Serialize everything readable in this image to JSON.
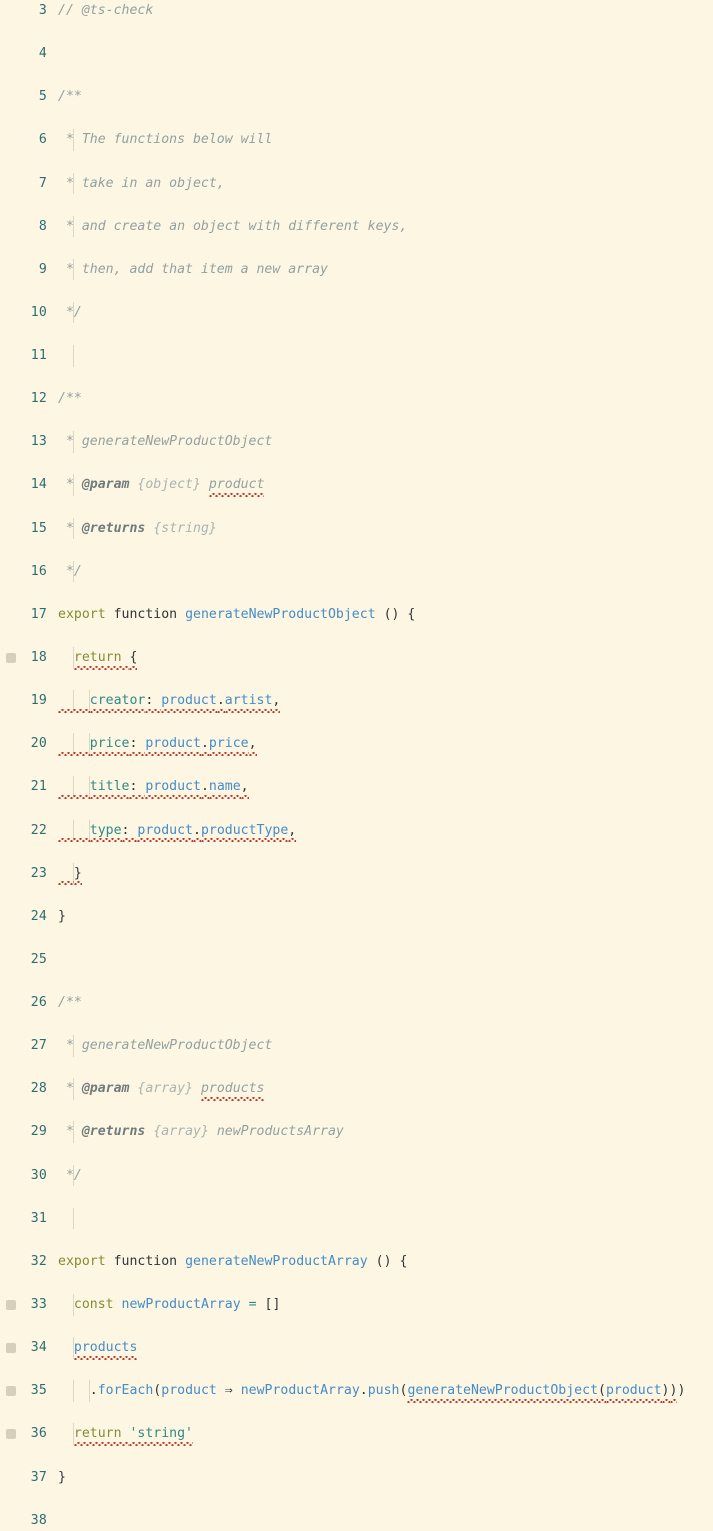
{
  "editor": {
    "theme": "Solarized Light",
    "language": "javascript",
    "colors": {
      "background": "#fdf6e3",
      "line_number": "#2e6d73",
      "comment": "#93a1a1",
      "keyword": "#8a8a35",
      "function_name": "#458cc9",
      "variable": "#458cc9",
      "property": "#2e8b84",
      "string": "#2e8b84",
      "punctuation": "#30373b",
      "error_squiggle": "#c0392b",
      "gutter_marker": "#cfc9b4",
      "indent_guide": "#ddd6c1"
    },
    "first_visible_line": 3,
    "last_visible_line": 38,
    "lines": [
      {
        "num": "3",
        "marker": false,
        "guides": [],
        "tokens": [
          {
            "t": "// @ts-check",
            "c": "c-com",
            "indent": 0
          }
        ]
      },
      {
        "num": "4",
        "marker": false,
        "guides": [],
        "tokens": []
      },
      {
        "num": "5",
        "marker": false,
        "guides": [],
        "tokens": [
          {
            "t": "/**",
            "c": "c-com",
            "indent": 0
          }
        ]
      },
      {
        "num": "6",
        "marker": false,
        "guides": [
          "g0"
        ],
        "tokens": [
          {
            "t": " * The functions below will",
            "c": "c-com",
            "indent": 0
          }
        ]
      },
      {
        "num": "7",
        "marker": false,
        "guides": [
          "g0"
        ],
        "tokens": [
          {
            "t": " * take in an object,",
            "c": "c-com",
            "indent": 0
          }
        ]
      },
      {
        "num": "8",
        "marker": false,
        "guides": [
          "g0"
        ],
        "tokens": [
          {
            "t": " * and create an object with different keys,",
            "c": "c-com",
            "indent": 0
          }
        ]
      },
      {
        "num": "9",
        "marker": false,
        "guides": [
          "g0"
        ],
        "tokens": [
          {
            "t": " * then, add that item a new array",
            "c": "c-com",
            "indent": 0
          }
        ]
      },
      {
        "num": "10",
        "marker": false,
        "guides": [
          "g0"
        ],
        "tokens": [
          {
            "t": " */",
            "c": "c-com",
            "indent": 0
          }
        ]
      },
      {
        "num": "11",
        "marker": false,
        "guides": [
          "g0"
        ],
        "tokens": []
      },
      {
        "num": "12",
        "marker": false,
        "guides": [],
        "tokens": [
          {
            "t": "/**",
            "c": "c-com",
            "indent": 0
          }
        ]
      },
      {
        "num": "13",
        "marker": false,
        "guides": [
          "g0"
        ],
        "tokens": [
          {
            "t": " * generateNewProductObject",
            "c": "c-com",
            "indent": 0
          }
        ]
      },
      {
        "num": "14",
        "marker": false,
        "guides": [
          "g0"
        ],
        "tokens": [
          {
            "t": " * ",
            "c": "c-com",
            "indent": 0
          },
          {
            "t": "@param",
            "c": "c-comtag"
          },
          {
            "t": " ",
            "c": "c-com"
          },
          {
            "t": "{object}",
            "c": "c-comtype"
          },
          {
            "t": " ",
            "c": "c-com"
          },
          {
            "t": "product",
            "c": "c-com",
            "sq": true
          }
        ]
      },
      {
        "num": "15",
        "marker": false,
        "guides": [
          "g0"
        ],
        "tokens": [
          {
            "t": " * ",
            "c": "c-com",
            "indent": 0
          },
          {
            "t": "@returns",
            "c": "c-comtag"
          },
          {
            "t": " ",
            "c": "c-com"
          },
          {
            "t": "{string}",
            "c": "c-comtype"
          }
        ]
      },
      {
        "num": "16",
        "marker": false,
        "guides": [
          "g0"
        ],
        "tokens": [
          {
            "t": " */",
            "c": "c-com",
            "indent": 0
          }
        ]
      },
      {
        "num": "17",
        "marker": false,
        "guides": [],
        "tokens": [
          {
            "t": "export",
            "c": "c-kw",
            "indent": 0
          },
          {
            "t": " ",
            "c": "c-plain"
          },
          {
            "t": "function",
            "c": "c-fn-kw"
          },
          {
            "t": " ",
            "c": "c-plain"
          },
          {
            "t": "generateNewProductObject",
            "c": "c-fname"
          },
          {
            "t": " () {",
            "c": "c-punc"
          }
        ]
      },
      {
        "num": "18",
        "marker": true,
        "guides": [
          "g0"
        ],
        "tokens": [
          {
            "t": "  ",
            "c": "c-plain",
            "indent": 0
          },
          {
            "t": "return",
            "c": "c-kw",
            "sq": true
          },
          {
            "t": " ",
            "c": "c-plain",
            "sq": true
          },
          {
            "t": "{",
            "c": "c-punc",
            "sq": true
          }
        ]
      },
      {
        "num": "19",
        "marker": false,
        "guides": [
          "g0",
          "g1"
        ],
        "tokens": [
          {
            "t": "    ",
            "c": "c-plain",
            "indent": 0,
            "sq": true
          },
          {
            "t": "creator",
            "c": "c-prop",
            "sq": true
          },
          {
            "t": ": ",
            "c": "c-punc",
            "sq": true
          },
          {
            "t": "product",
            "c": "c-var",
            "sq": true
          },
          {
            "t": ".",
            "c": "c-punc",
            "sq": true
          },
          {
            "t": "artist",
            "c": "c-var",
            "sq": true
          },
          {
            "t": ",",
            "c": "c-punc",
            "sq": true
          }
        ]
      },
      {
        "num": "20",
        "marker": false,
        "guides": [
          "g0",
          "g1"
        ],
        "tokens": [
          {
            "t": "    ",
            "c": "c-plain",
            "indent": 0,
            "sq": true
          },
          {
            "t": "price",
            "c": "c-prop",
            "sq": true
          },
          {
            "t": ": ",
            "c": "c-punc",
            "sq": true
          },
          {
            "t": "product",
            "c": "c-var",
            "sq": true
          },
          {
            "t": ".",
            "c": "c-punc",
            "sq": true
          },
          {
            "t": "price",
            "c": "c-var",
            "sq": true
          },
          {
            "t": ",",
            "c": "c-punc",
            "sq": true
          }
        ]
      },
      {
        "num": "21",
        "marker": false,
        "guides": [
          "g0",
          "g1"
        ],
        "tokens": [
          {
            "t": "    ",
            "c": "c-plain",
            "indent": 0,
            "sq": true
          },
          {
            "t": "title",
            "c": "c-prop",
            "sq": true
          },
          {
            "t": ": ",
            "c": "c-punc",
            "sq": true
          },
          {
            "t": "product",
            "c": "c-var",
            "sq": true
          },
          {
            "t": ".",
            "c": "c-punc",
            "sq": true
          },
          {
            "t": "name",
            "c": "c-var",
            "sq": true
          },
          {
            "t": ",",
            "c": "c-punc",
            "sq": true
          }
        ]
      },
      {
        "num": "22",
        "marker": false,
        "guides": [
          "g0",
          "g1"
        ],
        "tokens": [
          {
            "t": "    ",
            "c": "c-plain",
            "indent": 0,
            "sq": true
          },
          {
            "t": "type",
            "c": "c-prop",
            "sq": true
          },
          {
            "t": ": ",
            "c": "c-punc",
            "sq": true
          },
          {
            "t": "product",
            "c": "c-var",
            "sq": true
          },
          {
            "t": ".",
            "c": "c-punc",
            "sq": true
          },
          {
            "t": "productType",
            "c": "c-var",
            "sq": true
          },
          {
            "t": ",",
            "c": "c-punc",
            "sq": true
          }
        ]
      },
      {
        "num": "23",
        "marker": false,
        "guides": [
          "g0"
        ],
        "tokens": [
          {
            "t": "  ",
            "c": "c-plain",
            "indent": 0,
            "sq": true
          },
          {
            "t": "}",
            "c": "c-punc",
            "sq": true
          }
        ]
      },
      {
        "num": "24",
        "marker": false,
        "guides": [],
        "tokens": [
          {
            "t": "}",
            "c": "c-punc",
            "indent": 0
          }
        ]
      },
      {
        "num": "25",
        "marker": false,
        "guides": [],
        "tokens": []
      },
      {
        "num": "26",
        "marker": false,
        "guides": [],
        "tokens": [
          {
            "t": "/**",
            "c": "c-com",
            "indent": 0
          }
        ]
      },
      {
        "num": "27",
        "marker": false,
        "guides": [
          "g0"
        ],
        "tokens": [
          {
            "t": " * generateNewProductObject",
            "c": "c-com",
            "indent": 0
          }
        ]
      },
      {
        "num": "28",
        "marker": false,
        "guides": [
          "g0"
        ],
        "tokens": [
          {
            "t": " * ",
            "c": "c-com",
            "indent": 0
          },
          {
            "t": "@param",
            "c": "c-comtag"
          },
          {
            "t": " ",
            "c": "c-com"
          },
          {
            "t": "{array}",
            "c": "c-comtype"
          },
          {
            "t": " ",
            "c": "c-com"
          },
          {
            "t": "products",
            "c": "c-com",
            "sq": true
          }
        ]
      },
      {
        "num": "29",
        "marker": false,
        "guides": [
          "g0"
        ],
        "tokens": [
          {
            "t": " * ",
            "c": "c-com",
            "indent": 0
          },
          {
            "t": "@returns",
            "c": "c-comtag"
          },
          {
            "t": " ",
            "c": "c-com"
          },
          {
            "t": "{array}",
            "c": "c-comtype"
          },
          {
            "t": " newProductsArray",
            "c": "c-com"
          }
        ]
      },
      {
        "num": "30",
        "marker": false,
        "guides": [
          "g0"
        ],
        "tokens": [
          {
            "t": " */",
            "c": "c-com",
            "indent": 0
          }
        ]
      },
      {
        "num": "31",
        "marker": false,
        "guides": [
          "g0"
        ],
        "tokens": []
      },
      {
        "num": "32",
        "marker": false,
        "guides": [],
        "tokens": [
          {
            "t": "export",
            "c": "c-kw",
            "indent": 0
          },
          {
            "t": " ",
            "c": "c-plain"
          },
          {
            "t": "function",
            "c": "c-fn-kw"
          },
          {
            "t": " ",
            "c": "c-plain"
          },
          {
            "t": "generateNewProductArray",
            "c": "c-fname"
          },
          {
            "t": " () {",
            "c": "c-punc"
          }
        ]
      },
      {
        "num": "33",
        "marker": true,
        "guides": [
          "g0"
        ],
        "tokens": [
          {
            "t": "  ",
            "c": "c-plain",
            "indent": 0
          },
          {
            "t": "const",
            "c": "c-kw"
          },
          {
            "t": " ",
            "c": "c-plain"
          },
          {
            "t": "newProductArray",
            "c": "c-var"
          },
          {
            "t": " ",
            "c": "c-plain"
          },
          {
            "t": "=",
            "c": "c-op"
          },
          {
            "t": " ",
            "c": "c-plain"
          },
          {
            "t": "[]",
            "c": "c-punc"
          }
        ]
      },
      {
        "num": "34",
        "marker": true,
        "guides": [
          "g0"
        ],
        "tokens": [
          {
            "t": "  ",
            "c": "c-plain",
            "indent": 0
          },
          {
            "t": "products",
            "c": "c-var",
            "sq": true
          }
        ]
      },
      {
        "num": "35",
        "marker": true,
        "guides": [
          "g0",
          "g1"
        ],
        "tokens": [
          {
            "t": "    ",
            "c": "c-plain",
            "indent": 0
          },
          {
            "t": ".",
            "c": "c-punc"
          },
          {
            "t": "forEach",
            "c": "c-var"
          },
          {
            "t": "(",
            "c": "c-punc"
          },
          {
            "t": "product",
            "c": "c-var"
          },
          {
            "t": " ",
            "c": "c-plain"
          },
          {
            "t": "⇒",
            "c": "c-punc"
          },
          {
            "t": " ",
            "c": "c-plain"
          },
          {
            "t": "newProductArray",
            "c": "c-var"
          },
          {
            "t": ".",
            "c": "c-punc"
          },
          {
            "t": "push",
            "c": "c-var"
          },
          {
            "t": "(",
            "c": "c-punc"
          },
          {
            "t": "generateNewProductObject",
            "c": "c-fname",
            "sq": true
          },
          {
            "t": "(",
            "c": "c-punc",
            "sq": true
          },
          {
            "t": "product",
            "c": "c-var",
            "sq": true
          },
          {
            "t": ")",
            "c": "c-punc",
            "sq": true
          },
          {
            "t": ")",
            "c": "c-punc",
            "sq": true
          },
          {
            "t": ")",
            "c": "c-punc"
          }
        ]
      },
      {
        "num": "36",
        "marker": true,
        "guides": [
          "g0"
        ],
        "tokens": [
          {
            "t": "  ",
            "c": "c-plain",
            "indent": 0
          },
          {
            "t": "return",
            "c": "c-kw",
            "sq": true
          },
          {
            "t": " ",
            "c": "c-plain",
            "sq": true
          },
          {
            "t": "'string'",
            "c": "c-str",
            "sq": true
          }
        ]
      },
      {
        "num": "37",
        "marker": false,
        "guides": [],
        "tokens": [
          {
            "t": "}",
            "c": "c-punc",
            "indent": 0
          }
        ]
      },
      {
        "num": "38",
        "marker": false,
        "guides": [],
        "tokens": []
      }
    ]
  }
}
